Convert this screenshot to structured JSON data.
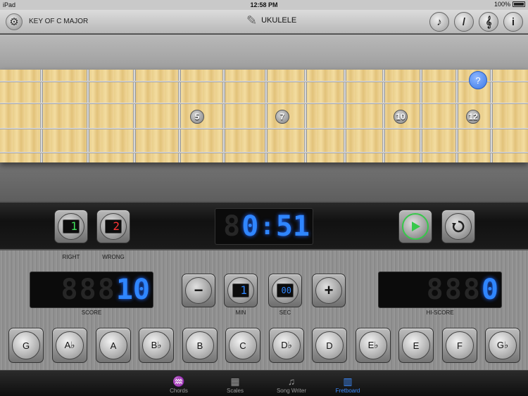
{
  "status": {
    "device": "iPad",
    "time": "12:58 PM",
    "battery": "100%"
  },
  "nav": {
    "key": "KEY OF C MAJOR",
    "title": "UKULELE",
    "tools": [
      {
        "name": "note-icon",
        "glyph": "♪"
      },
      {
        "name": "pick-icon",
        "glyph": "/"
      },
      {
        "name": "treble-clef-icon",
        "glyph": "𝄞"
      },
      {
        "name": "info-icon",
        "glyph": "i"
      }
    ]
  },
  "fretboard": {
    "markers": [
      "5",
      "7",
      "10",
      "12"
    ],
    "question": "?"
  },
  "timer": {
    "right_count": "1",
    "wrong_count": "2",
    "time": {
      "minutes": "0",
      "sep": ":",
      "seconds": "51"
    },
    "right_label": "RIGHT",
    "wrong_label": "WRONG"
  },
  "score": {
    "score_value": "10",
    "score_label": "SCORE",
    "min_value": "1",
    "min_label": "MIN",
    "sec_value": "00",
    "sec_label": "SEC",
    "hiscore_value": "0",
    "hiscore_label": "HI-SCORE",
    "minus": "−",
    "plus": "+"
  },
  "notes": [
    "G",
    "A♭",
    "A",
    "B♭",
    "B",
    "C",
    "D♭",
    "D",
    "E♭",
    "E",
    "F",
    "G♭"
  ],
  "tabs": [
    {
      "label": "Chords",
      "icon": "guitar-icon",
      "glyph": "♒",
      "active": false
    },
    {
      "label": "Scales",
      "icon": "scale-icon",
      "glyph": "▦",
      "active": false
    },
    {
      "label": "Song Writer",
      "icon": "song-writer-icon",
      "glyph": "♫",
      "active": false
    },
    {
      "label": "Fretboard",
      "icon": "fretboard-icon",
      "glyph": "▥",
      "active": true
    }
  ],
  "colors": {
    "lcd_on": "#2f86ff",
    "active_tab": "#3d8cff",
    "right_lcd": "#3fe35a",
    "wrong_lcd": "#ff3434",
    "play": "#37c84b"
  }
}
